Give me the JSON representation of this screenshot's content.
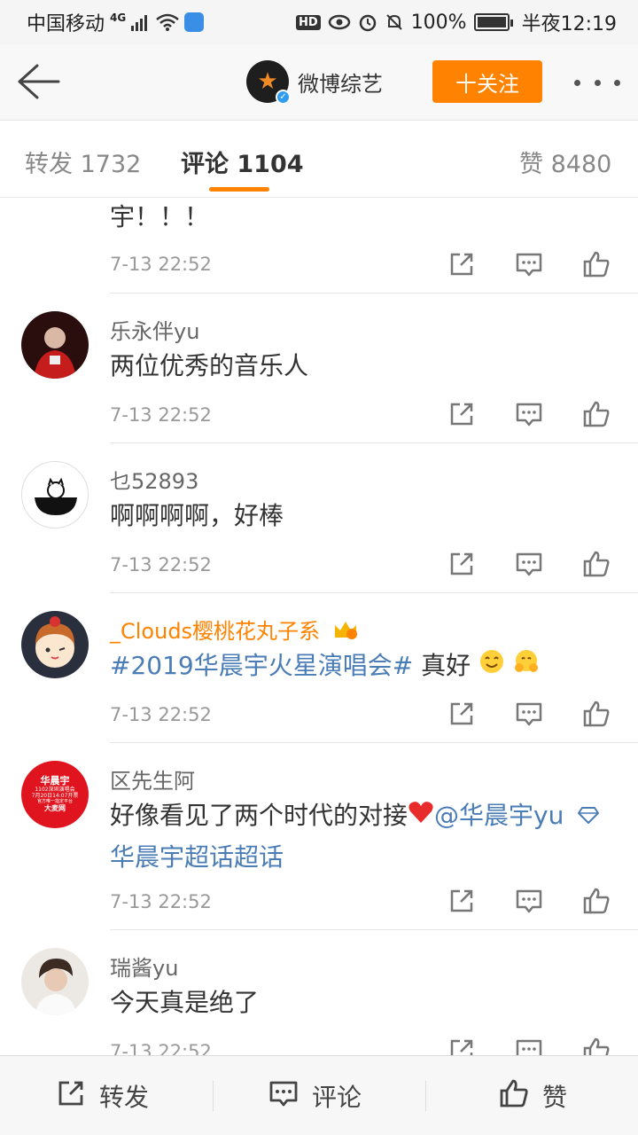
{
  "status_bar": {
    "carrier": "中国移动",
    "network": "4G",
    "battery": "100%",
    "battery_level": 1.0,
    "time": "半夜12:19"
  },
  "header": {
    "account_name": "微博综艺",
    "follow_label": "十关注"
  },
  "tabs": [
    {
      "label": "转发 1732"
    },
    {
      "label": "评论 1104"
    },
    {
      "label": "赞 8480"
    }
  ],
  "comments": [
    {
      "user": "",
      "text": "宇！！！",
      "time": "7-13 22:52"
    },
    {
      "user": "乐永伴yu",
      "text": "两位优秀的音乐人",
      "time": "7-13 22:52"
    },
    {
      "user": "乜52893",
      "text": "啊啊啊啊，好棒",
      "time": "7-13 22:52"
    },
    {
      "user": "_Clouds樱桃花丸子系",
      "topic": "#2019华晨宇火星演唱会#",
      "text": " 真好",
      "time": "7-13 22:52"
    },
    {
      "user": "区先生阿",
      "text": "好像看见了两个时代的对接",
      "mention": "@华晨宇yu",
      "supertopic": "华晨宇超话超话",
      "time": "7-13 22:52",
      "avatar_text": {
        "line1": "华晨宇",
        "line2": "1102深圳演唱会",
        "line3": "7月20日14:07开票",
        "line4": "官方唯一指定平台",
        "line5": "大麦网"
      }
    },
    {
      "user": "瑞酱yu",
      "text": "今天真是绝了",
      "time": "7-13 22:52"
    }
  ],
  "bottom_bar": {
    "repost": "转发",
    "comment": "评论",
    "like": "赞"
  },
  "colors": {
    "accent": "#ff8200",
    "link": "#4a7cb6"
  }
}
